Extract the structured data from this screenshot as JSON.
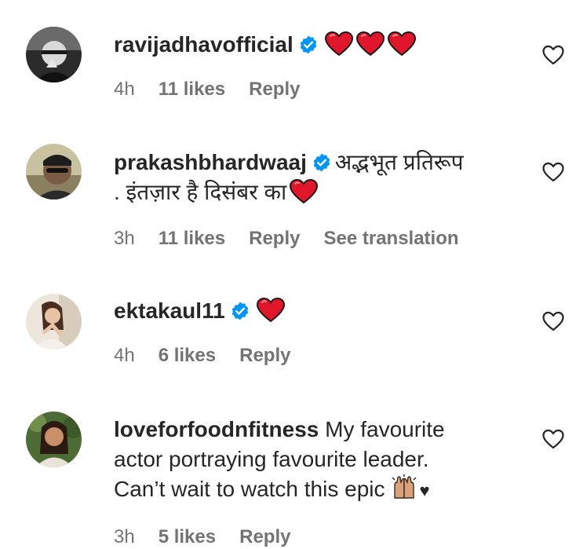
{
  "comments": [
    {
      "username": "ravijadhavofficial",
      "text": "",
      "time": "4h",
      "likes": "11 likes",
      "reply": "Reply"
    },
    {
      "username": "prakashbhardwaaj",
      "text_line1": "अद्भभूत प्रतिरूप",
      "text_line2": ". इंतज़ार है दिसंबर का",
      "time": "3h",
      "likes": "11 likes",
      "reply": "Reply",
      "translation": "See translation"
    },
    {
      "username": "ektakaul11",
      "text": "",
      "time": "4h",
      "likes": "6 likes",
      "reply": "Reply"
    },
    {
      "username": "loveforfoodnfitness",
      "text_line1": "My favourite",
      "text_line2": "actor portraying favourite leader.",
      "text_line3": "Can’t wait to watch this epic",
      "text_suffix": "♥",
      "time": "3h",
      "likes": "5 likes",
      "reply": "Reply"
    }
  ],
  "colors": {
    "text": "#262626",
    "meta": "#737373",
    "verified": "#0095f6",
    "heart_emoji": "#e0162b"
  },
  "icons": {
    "verified": "verified-badge-icon",
    "like": "heart-outline-icon",
    "emoji_heart": "red-heart-emoji",
    "emoji_hands": "raising-hands-emoji"
  }
}
